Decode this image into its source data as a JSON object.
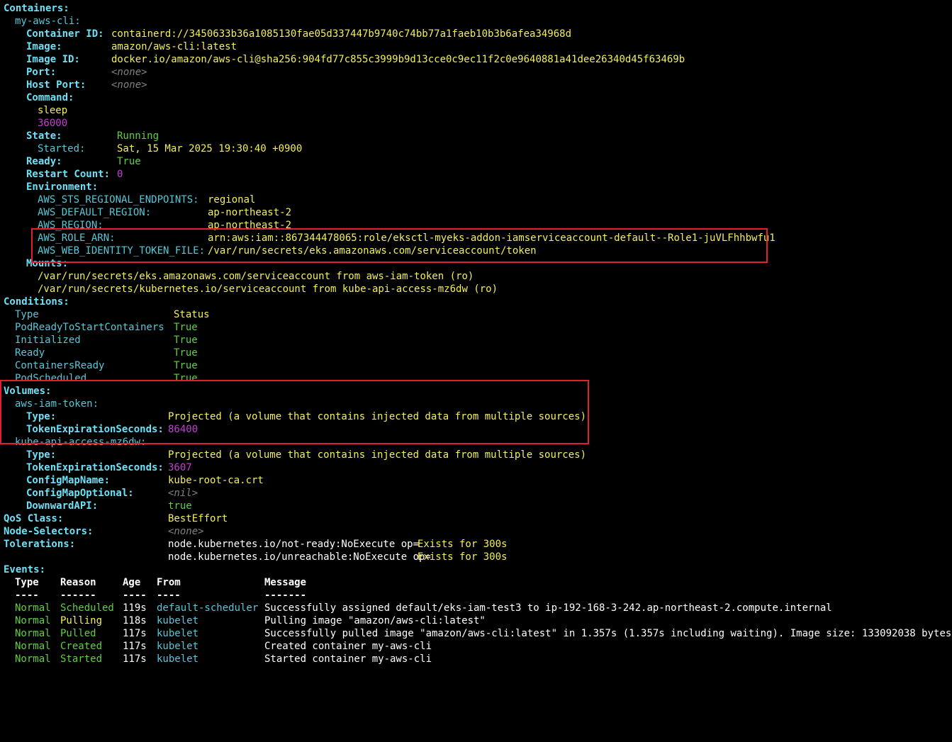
{
  "containers": {
    "header": "Containers:",
    "name": "my-aws-cli:",
    "container_id": {
      "label": "Container ID:",
      "value": "containerd://3450633b36a1085130fae05d337447b9740c74bb77a1faeb10b3b6afea34968d"
    },
    "image": {
      "label": "Image:",
      "value": "amazon/aws-cli:latest"
    },
    "image_id": {
      "label": "Image ID:",
      "value": "docker.io/amazon/aws-cli@sha256:904fd77c855c3999b9d13cce0c9ec11f2c0e9640881a41dee26340d45f63469b"
    },
    "port": {
      "label": "Port:",
      "value": "<none>"
    },
    "host_port": {
      "label": "Host Port:",
      "value": "<none>"
    },
    "command": {
      "label": "Command:",
      "values": [
        "sleep",
        "36000"
      ]
    },
    "state": {
      "label": "State:",
      "value": "Running"
    },
    "started": {
      "label": "Started:",
      "value": "Sat, 15 Mar 2025 19:30:40 +0900"
    },
    "ready": {
      "label": "Ready:",
      "value": "True"
    },
    "restart_count": {
      "label": "Restart Count:",
      "value": "0"
    },
    "environment": {
      "label": "Environment:",
      "vars": [
        {
          "key": "AWS_STS_REGIONAL_ENDPOINTS:",
          "value": "regional"
        },
        {
          "key": "AWS_DEFAULT_REGION:",
          "value": "ap-northeast-2"
        },
        {
          "key": "AWS_REGION:",
          "value": "ap-northeast-2"
        },
        {
          "key": "AWS_ROLE_ARN:",
          "value": "arn:aws:iam::867344478065:role/eksctl-myeks-addon-iamserviceaccount-default--Role1-juVLFhhbwfu1"
        },
        {
          "key": "AWS_WEB_IDENTITY_TOKEN_FILE:",
          "value": "/var/run/secrets/eks.amazonaws.com/serviceaccount/token"
        }
      ]
    },
    "mounts": {
      "label": "Mounts:",
      "items": [
        "/var/run/secrets/eks.amazonaws.com/serviceaccount from aws-iam-token (ro)",
        "/var/run/secrets/kubernetes.io/serviceaccount from kube-api-access-mz6dw (ro)"
      ]
    }
  },
  "conditions": {
    "header": "Conditions:",
    "col_type": "Type",
    "col_status": "Status",
    "rows": [
      {
        "type": "PodReadyToStartContainers",
        "status": "True"
      },
      {
        "type": "Initialized",
        "status": "True"
      },
      {
        "type": "Ready",
        "status": "True"
      },
      {
        "type": "ContainersReady",
        "status": "True"
      },
      {
        "type": "PodScheduled",
        "status": "True"
      }
    ]
  },
  "volumes": {
    "header": "Volumes:",
    "aws_iam_token": {
      "name": "aws-iam-token:",
      "type": {
        "label": "Type:",
        "value": "Projected (a volume that contains injected data from multiple sources)"
      },
      "token_exp": {
        "label": "TokenExpirationSeconds:",
        "value": "86400"
      }
    },
    "kube_api": {
      "name": "kube-api-access-mz6dw:",
      "type": {
        "label": "Type:",
        "value": "Projected (a volume that contains injected data from multiple sources)"
      },
      "token_exp": {
        "label": "TokenExpirationSeconds:",
        "value": "3607"
      },
      "configmap_name": {
        "label": "ConfigMapName:",
        "value": "kube-root-ca.crt"
      },
      "configmap_optional": {
        "label": "ConfigMapOptional:",
        "value": "<nil>"
      },
      "downward_api": {
        "label": "DownwardAPI:",
        "value": "true"
      }
    }
  },
  "qos": {
    "label": "QoS Class:",
    "value": "BestEffort"
  },
  "node_selectors": {
    "label": "Node-Selectors:",
    "value": "<none>"
  },
  "tolerations": {
    "label": "Tolerations:",
    "items": [
      {
        "key": "node.kubernetes.io/not-ready:NoExecute op=",
        "op": "Exists for 300s"
      },
      {
        "key": "node.kubernetes.io/unreachable:NoExecute op=",
        "op": "Exists for 300s"
      }
    ]
  },
  "events": {
    "header": "Events:",
    "columns": {
      "type": "Type",
      "reason": "Reason",
      "age": "Age",
      "from": "From",
      "message": "Message"
    },
    "dashes": {
      "type": "----",
      "reason": "------",
      "age": "----",
      "from": "----",
      "message": "-------"
    },
    "rows": [
      {
        "type": "Normal",
        "reason": "Scheduled",
        "age": "119s",
        "from": "default-scheduler",
        "message": "Successfully assigned default/eks-iam-test3 to ip-192-168-3-242.ap-northeast-2.compute.internal"
      },
      {
        "type": "Normal",
        "reason": "Pulling",
        "age": "118s",
        "from": "kubelet",
        "message": "Pulling image \"amazon/aws-cli:latest\""
      },
      {
        "type": "Normal",
        "reason": "Pulled",
        "age": "117s",
        "from": "kubelet",
        "message": "Successfully pulled image \"amazon/aws-cli:latest\" in 1.357s (1.357s including waiting). Image size: 133092038 bytes."
      },
      {
        "type": "Normal",
        "reason": "Created",
        "age": "117s",
        "from": "kubelet",
        "message": "Created container my-aws-cli"
      },
      {
        "type": "Normal",
        "reason": "Started",
        "age": "117s",
        "from": "kubelet",
        "message": "Started container my-aws-cli"
      }
    ]
  },
  "colors": {
    "highlight_box": "#e0202e",
    "background": "#000000"
  }
}
